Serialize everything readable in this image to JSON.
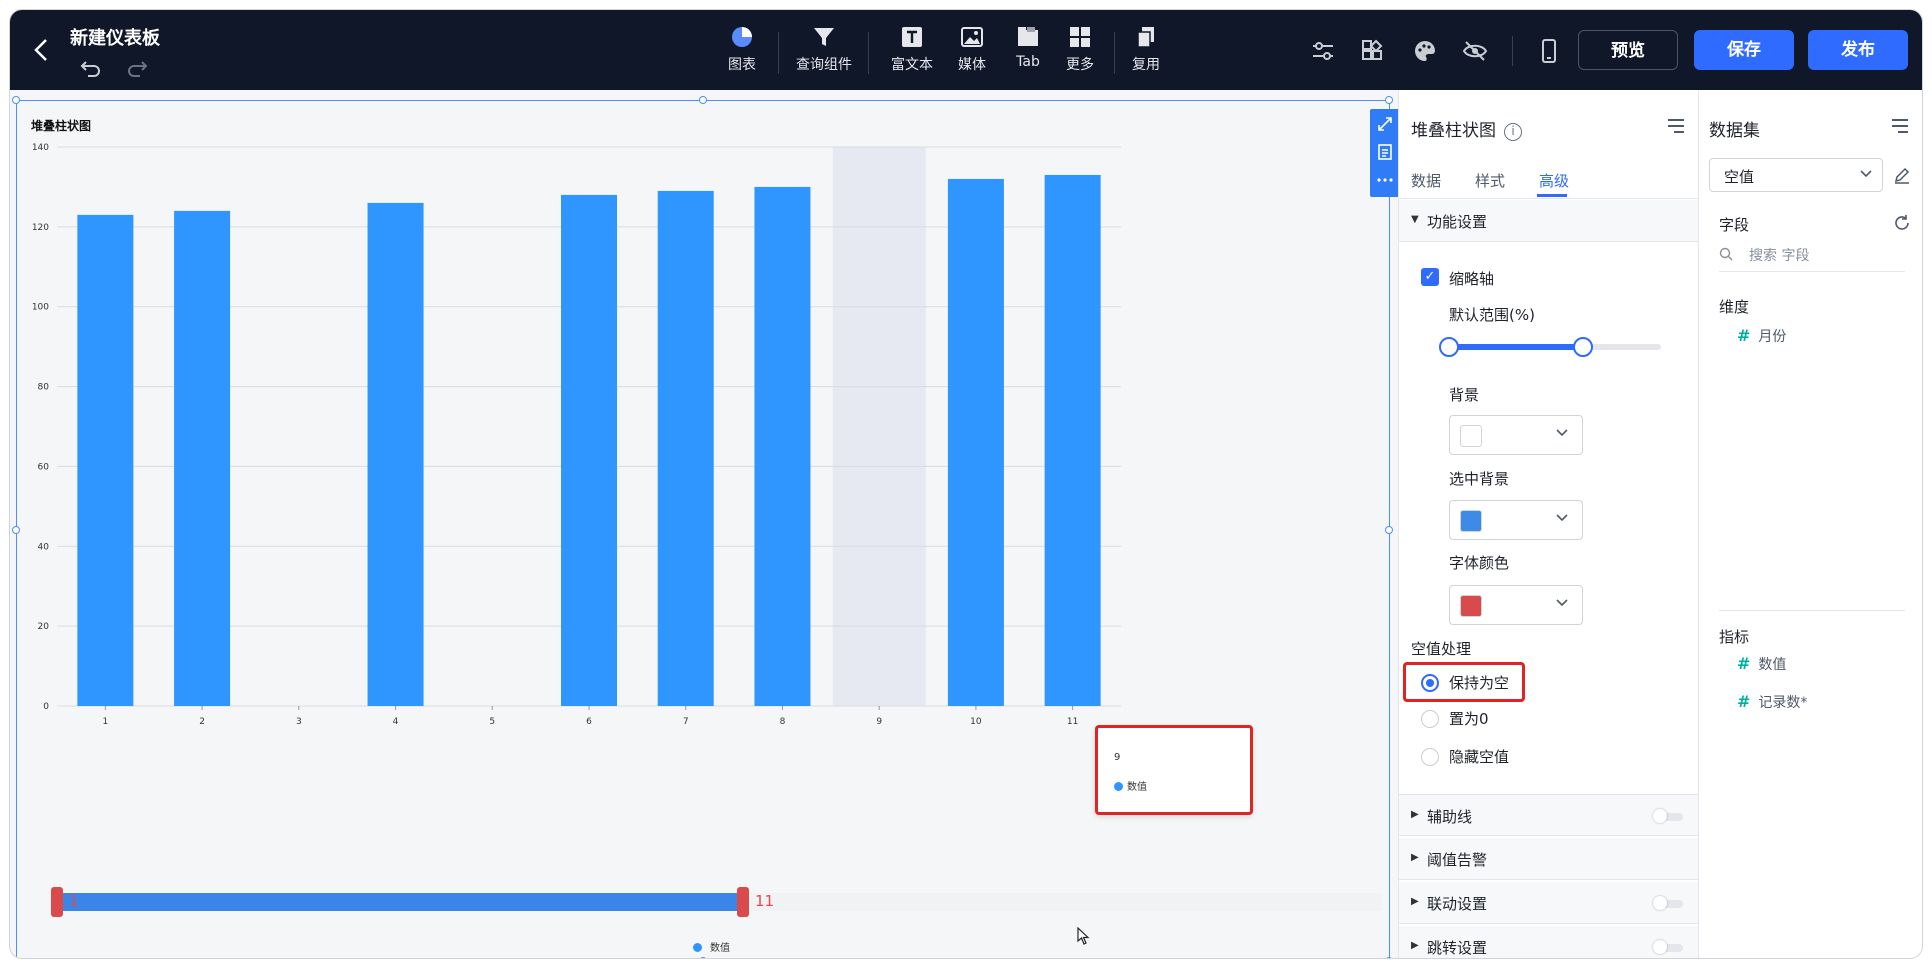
{
  "header": {
    "title": "新建仪表板",
    "toolbar": [
      {
        "label": "图表",
        "icon": "pie-chart-icon"
      },
      {
        "label": "查询组件",
        "icon": "filter-icon"
      },
      {
        "label": "富文本",
        "icon": "text-icon"
      },
      {
        "label": "媒体",
        "icon": "image-icon"
      },
      {
        "label": "Tab",
        "icon": "tab-icon"
      },
      {
        "label": "更多",
        "icon": "grid-icon"
      },
      {
        "label": "复用",
        "icon": "copy-icon"
      }
    ],
    "preview_label": "预览",
    "save_label": "保存",
    "publish_label": "发布"
  },
  "chart": {
    "title": "堆叠柱状图",
    "slider_start": "1",
    "slider_end": "11",
    "legend_label": "数值",
    "tooltip_title": "9",
    "tooltip_series": "数值"
  },
  "chart_data": {
    "type": "bar",
    "title": "堆叠柱状图",
    "categories": [
      "1",
      "2",
      "3",
      "4",
      "5",
      "6",
      "7",
      "8",
      "9",
      "10",
      "11"
    ],
    "series": [
      {
        "name": "数值",
        "values": [
          123,
          124,
          null,
          126,
          null,
          128,
          129,
          130,
          null,
          132,
          133
        ]
      }
    ],
    "ylim": [
      0,
      140
    ],
    "yticks": [
      0,
      20,
      40,
      60,
      80,
      100,
      120,
      140
    ],
    "highlighted_category": "9",
    "color": "#2f95ff",
    "grid": true,
    "legend_position": "bottom"
  },
  "config_panel": {
    "title": "堆叠柱状图",
    "tabs": [
      "数据",
      "样式",
      "高级"
    ],
    "active_tab": "高级",
    "section_function": "功能设置",
    "zoom_axis_label": "缩略轴",
    "zoom_axis_checked": true,
    "default_range_label": "默认范围(%)",
    "default_range": [
      0,
      63
    ],
    "background_label": "背景",
    "background_color": "#ffffff",
    "selected_bg_label": "选中背景",
    "selected_bg_color": "#3d8be6",
    "font_color_label": "字体颜色",
    "font_color": "#d94a4a",
    "null_handling_label": "空值处理",
    "null_options": [
      "保持为空",
      "置为0",
      "隐藏空值"
    ],
    "null_selected": "保持为空",
    "collapsed_sections": [
      "辅助线",
      "阈值告警",
      "联动设置",
      "跳转设置"
    ]
  },
  "dataset_panel": {
    "title": "数据集",
    "selected_dataset": "空值",
    "fields_label": "字段",
    "search_placeholder": "搜索 字段",
    "dimension_label": "维度",
    "dimensions": [
      "月份"
    ],
    "metric_label": "指标",
    "metrics": [
      "数值",
      "记录数*"
    ]
  }
}
